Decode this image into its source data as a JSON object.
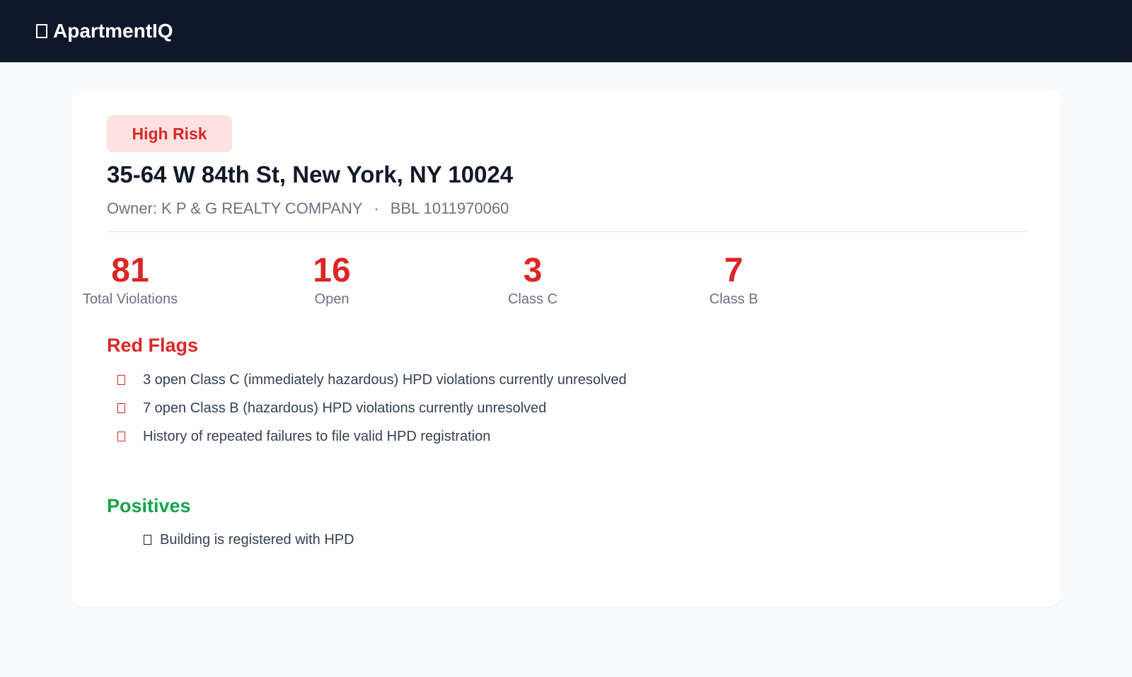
{
  "app": {
    "brand": "ApartmentIQ"
  },
  "building": {
    "risk_label": "High Risk",
    "address": "35-64 W 84th St, New York, NY 10024",
    "owner_prefix": "Owner:",
    "owner": "K P & G REALTY COMPANY",
    "separator": "·",
    "bbl_label": "BBL",
    "bbl": "1011970060"
  },
  "stats": [
    {
      "value": "81",
      "label": "Total Violations"
    },
    {
      "value": "16",
      "label": "Open"
    },
    {
      "value": "3",
      "label": "Class C"
    },
    {
      "value": "7",
      "label": "Class B"
    }
  ],
  "red_flags": {
    "title": "Red Flags",
    "items": [
      "3 open Class C (immediately hazardous) HPD violations currently unresolved",
      "7 open Class B (hazardous) HPD violations currently unresolved",
      "History of repeated failures to file valid HPD registration"
    ]
  },
  "positives": {
    "title": "Positives",
    "items": [
      "Building is registered with HPD"
    ]
  },
  "colors": {
    "topbar": "#0f172a",
    "danger": "#dc2626",
    "danger_bg": "#fee2e2",
    "success": "#16a34a"
  }
}
